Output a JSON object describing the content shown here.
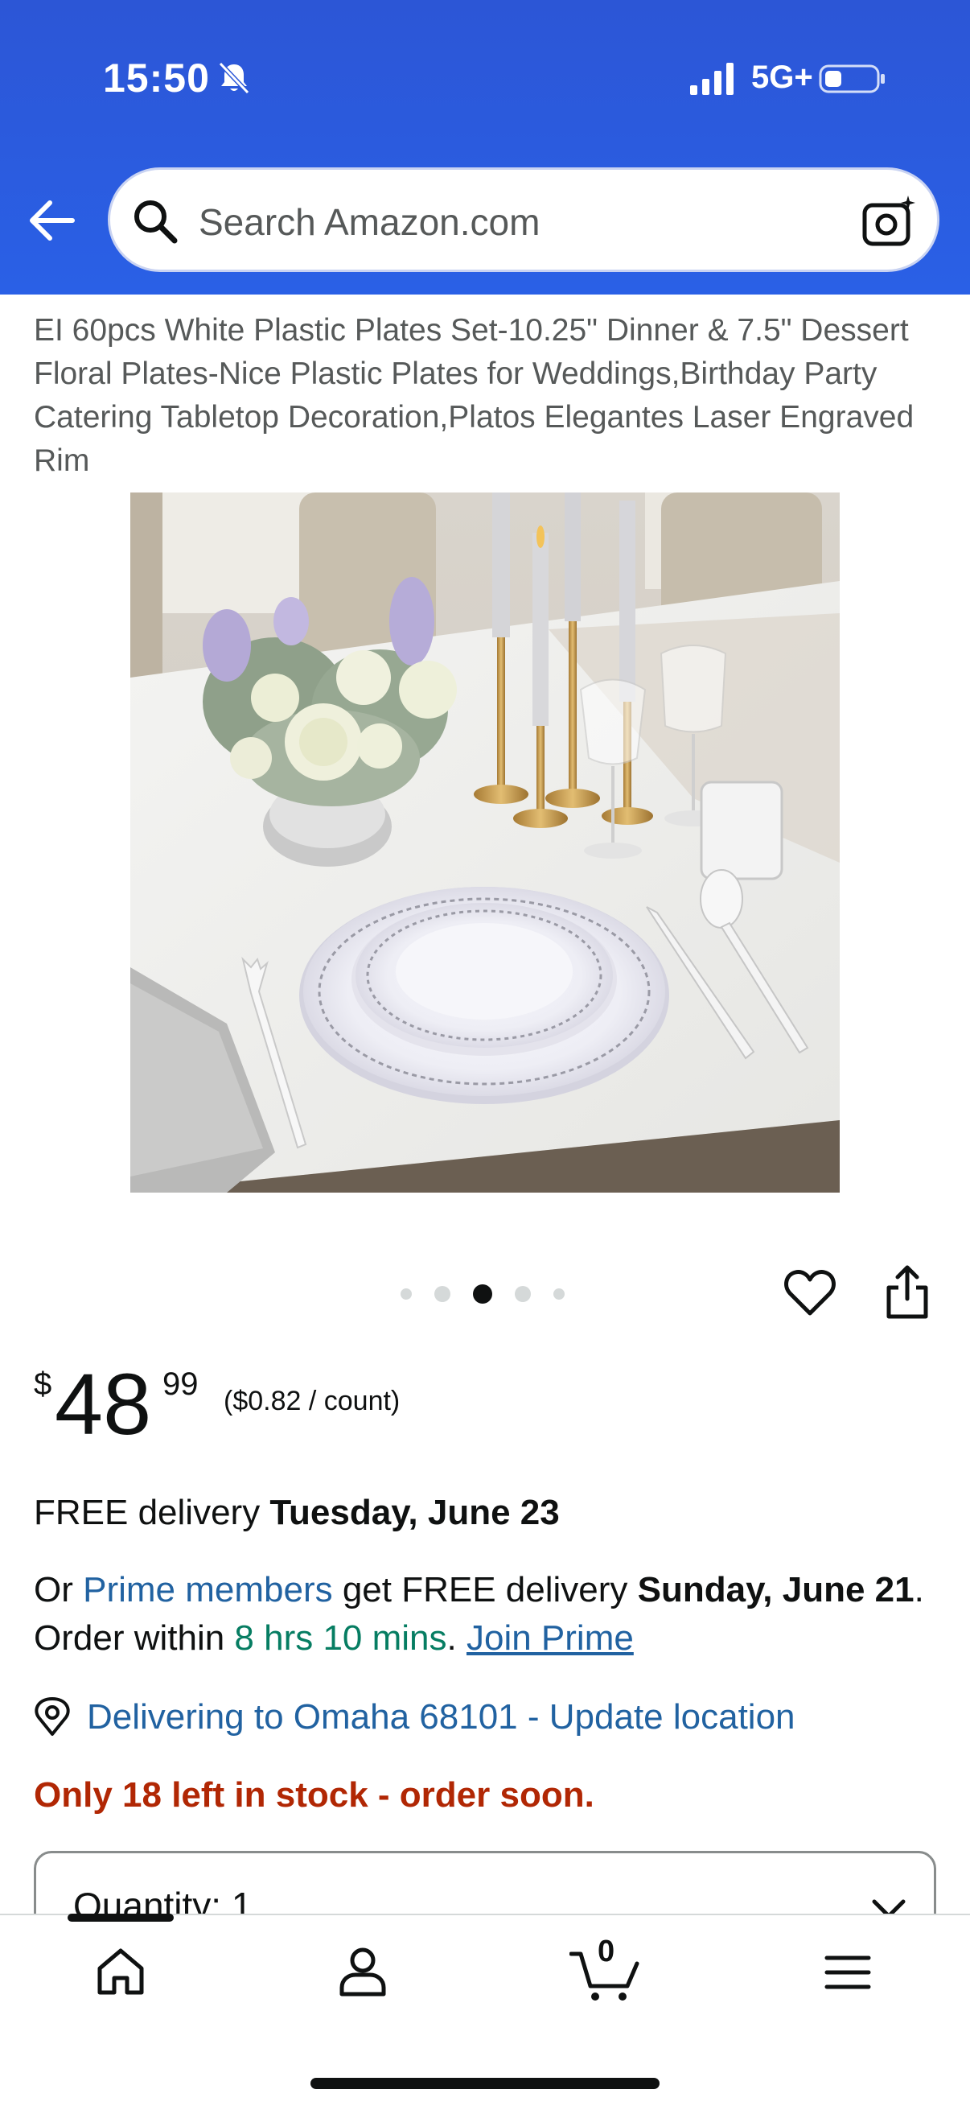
{
  "status_bar": {
    "time": "15:50",
    "network": "5G+"
  },
  "search": {
    "placeholder": "Search Amazon.com"
  },
  "product": {
    "title": "EI 60pcs White Plastic Plates Set-10.25\" Dinner & 7.5\" Dessert Floral Plates-Nice Plastic Plates for Weddings,Birthday Party Catering Tabletop Decoration,Platos Elegantes Laser Engraved Rim",
    "image_count": 5,
    "active_image": 3
  },
  "price": {
    "symbol": "$",
    "whole": "48",
    "fraction": "99",
    "unit_price": "($0.82 / count)"
  },
  "delivery": {
    "free_prefix": "FREE delivery ",
    "free_date": "Tuesday, June 23",
    "or": "Or ",
    "prime_members": "Prime members",
    "prime_text": " get FREE delivery ",
    "prime_date": "Sunday, June 21",
    "order_within_prefix": ". Order within ",
    "order_within": "8 hrs 10 mins",
    "period": ". ",
    "join_prime": "Join Prime",
    "location": "Delivering to Omaha 68101 - Update location"
  },
  "stock": "Only 18 left in stock - order soon.",
  "quantity": {
    "label": "Quantity: 1"
  },
  "nav": {
    "cart_count": "0"
  },
  "colors": {
    "header": "#2a5fe4",
    "link": "#2162a1",
    "stock": "#b12704",
    "green": "#067d62"
  }
}
